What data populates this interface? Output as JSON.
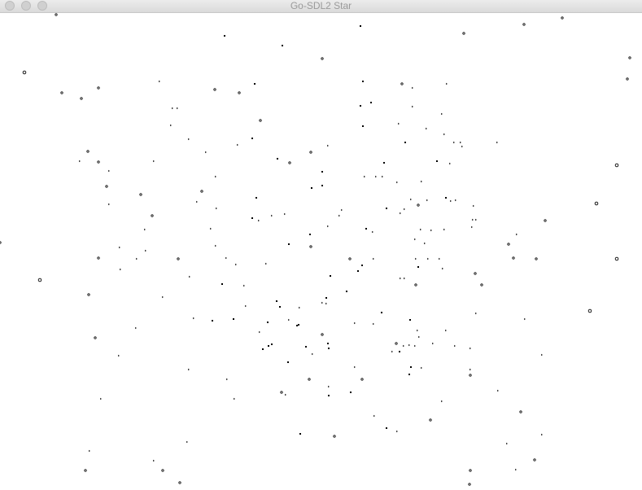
{
  "window": {
    "title": "Go-SDL2 Star",
    "controls": [
      "close",
      "minimize",
      "zoom"
    ]
  },
  "canvas": {
    "background_color": "#ffffff",
    "star_color": "#000000",
    "content": "starfield"
  }
}
